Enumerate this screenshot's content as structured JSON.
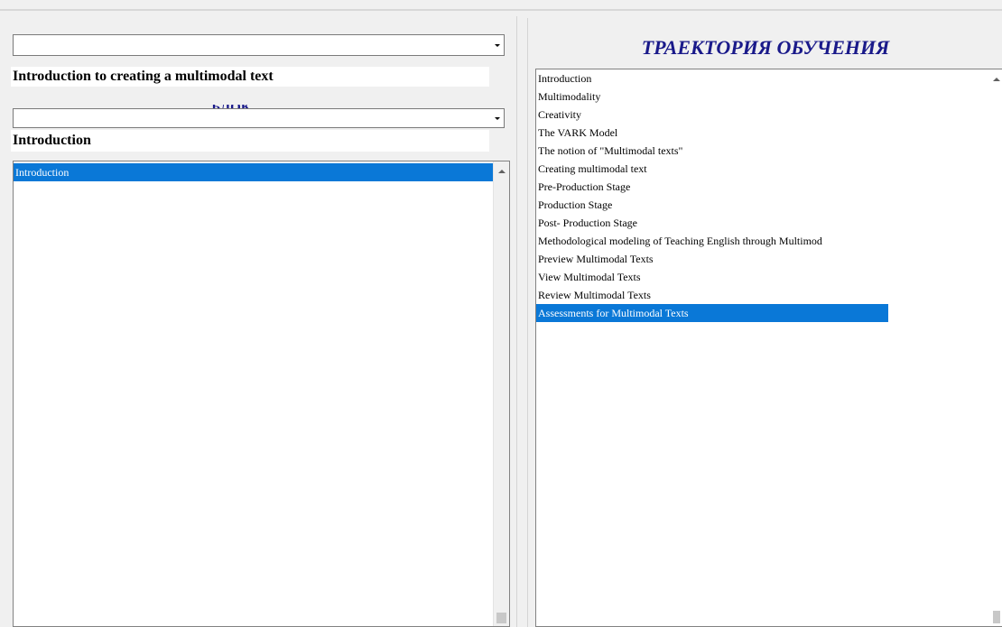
{
  "left": {
    "module_combo": {
      "value": ""
    },
    "module_title": "Introduction to creating a multimodal text",
    "blok_title": "БЛОК",
    "block_combo": {
      "value": ""
    },
    "block_title": "Introduction",
    "topic_list": [
      {
        "label": "Introduction",
        "selected": true
      }
    ]
  },
  "right": {
    "title": "ТРАЕКТОРИЯ ОБУЧЕНИЯ",
    "trajectory_list": [
      {
        "label": "Introduction",
        "selected": false
      },
      {
        "label": "Multimodality",
        "selected": false
      },
      {
        "label": "Creativity",
        "selected": false
      },
      {
        "label": "The VARK Model",
        "selected": false
      },
      {
        "label": "The notion of \"Multimodal texts\"",
        "selected": false
      },
      {
        "label": "Creating multimodal text",
        "selected": false
      },
      {
        "label": "Pre-Production Stage",
        "selected": false
      },
      {
        "label": "Production Stage",
        "selected": false
      },
      {
        "label": "Post- Production Stage",
        "selected": false
      },
      {
        "label": "Methodological modeling of Teaching English through Multimod",
        "selected": false
      },
      {
        "label": "Preview Multimodal Texts",
        "selected": false
      },
      {
        "label": "View Multimodal Texts",
        "selected": false
      },
      {
        "label": "Review Multimodal Texts",
        "selected": false
      },
      {
        "label": "Assessments for Multimodal Texts",
        "selected": true
      }
    ]
  },
  "colors": {
    "selection": "#0a78d7",
    "title_blue": "#1a1a8a",
    "window_bg": "#f0f0f0"
  }
}
